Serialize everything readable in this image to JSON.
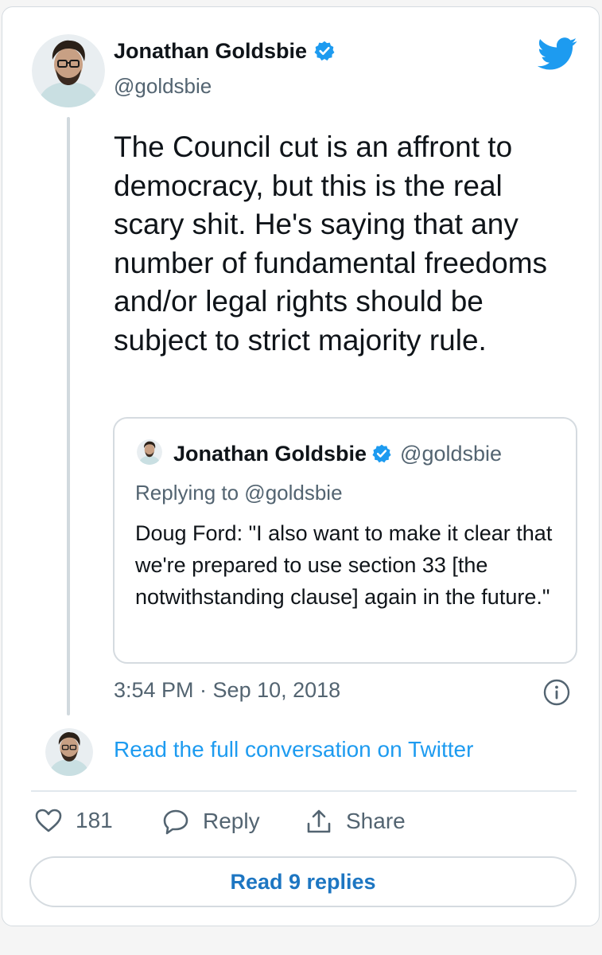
{
  "tweet": {
    "author_name": "Jonathan Goldsbie",
    "handle": "@goldsbie",
    "text": "The Council cut is an affront to democracy, but this is the real scary shit. He's saying that any number of fundamental freedoms and/or legal rights should be subject to strict majority rule.",
    "timestamp": "3:54 PM · Sep 10, 2018"
  },
  "quote": {
    "author_name": "Jonathan Goldsbie",
    "handle": "@goldsbie",
    "replying_to": "Replying to @goldsbie",
    "text": "Doug Ford: \"I also want to make it clear that we're prepared to use section 33 [the notwithstanding clause] again in the future.\""
  },
  "conversation_link": "Read the full conversation on Twitter",
  "actions": {
    "like_count": "181",
    "reply_label": "Reply",
    "share_label": "Share"
  },
  "read_replies_label": "Read 9 replies",
  "colors": {
    "brand_blue": "#1d9bf0",
    "verified_blue": "#1d9bf0",
    "secondary_text": "#536471",
    "border": "#d5dbe0"
  },
  "icons": {
    "verified": "verified-badge-icon",
    "brand": "twitter-bird-icon",
    "info": "info-icon",
    "like": "heart-icon",
    "reply": "speech-bubble-icon",
    "share": "share-arrow-icon"
  }
}
